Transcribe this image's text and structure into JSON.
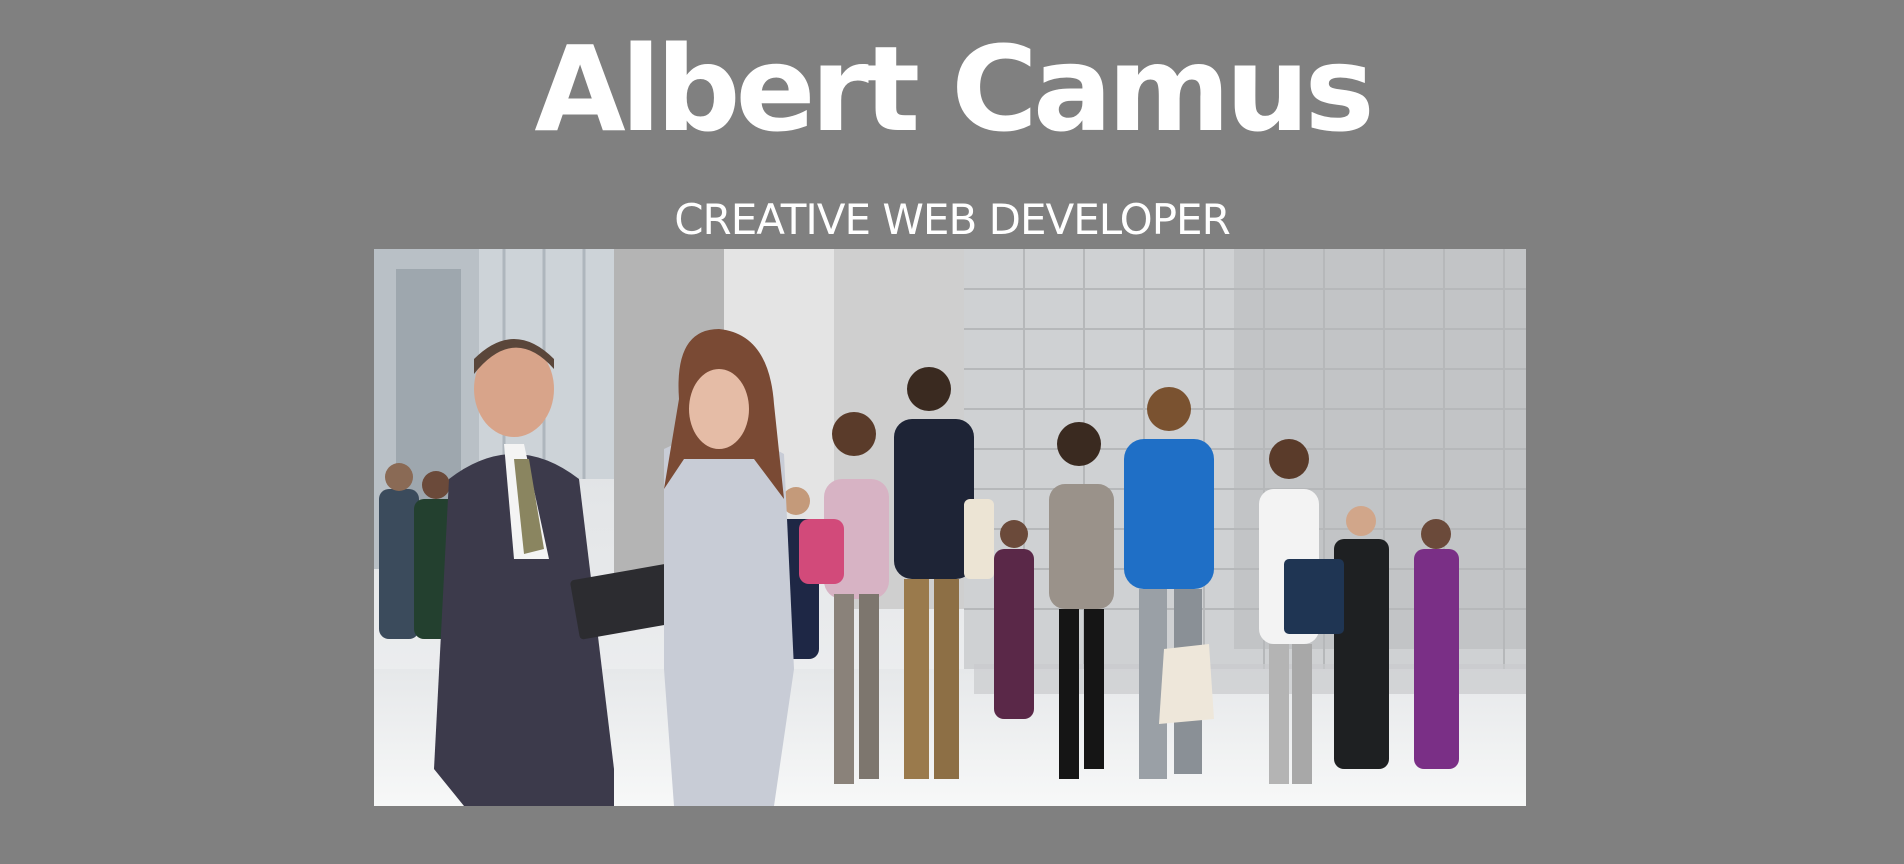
{
  "header": {
    "name": "Albert Camus",
    "tagline": "CREATIVE WEB DEVELOPER"
  },
  "colors": {
    "background": "#808080",
    "text": "#ffffff"
  }
}
